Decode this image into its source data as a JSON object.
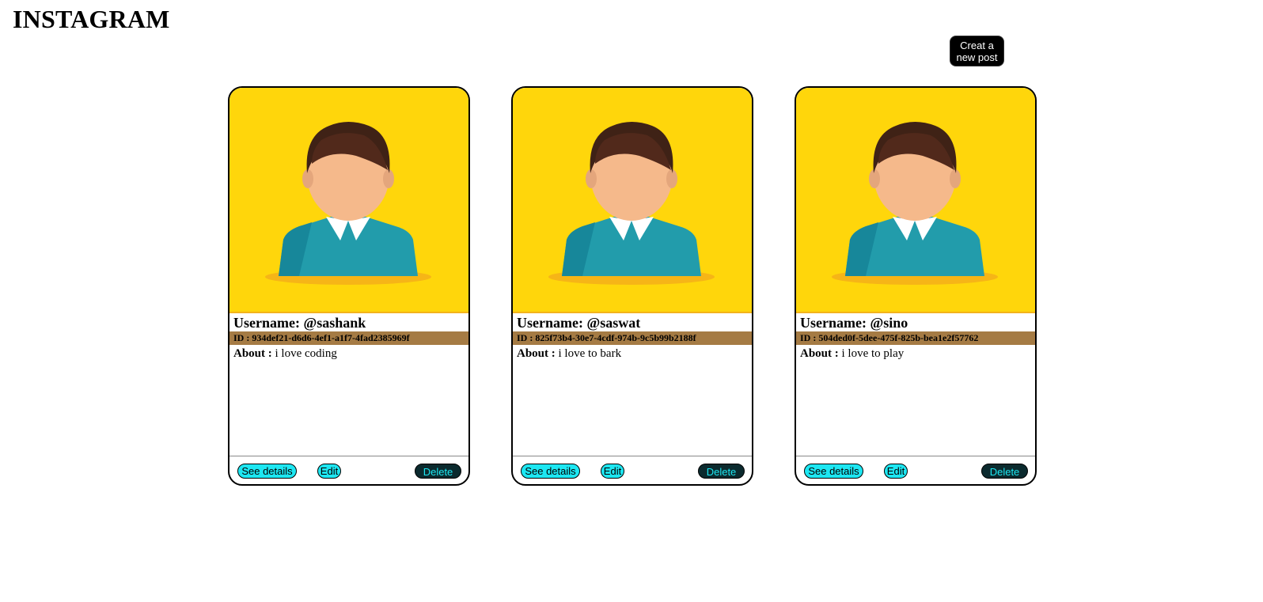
{
  "app": {
    "title": "INSTAGRAM"
  },
  "toolbar": {
    "create_label": "Creat a\nnew post"
  },
  "colors": {
    "avatar_bg": "#ffd60b",
    "id_bar": "#a57b44",
    "button_cyan": "#1de7f2",
    "delete_bg": "#0b2a2e"
  },
  "cards": [
    {
      "avatar_icon": "person-avatar-icon",
      "username_label": "Username:",
      "username": "@sashank",
      "id_label": "ID :",
      "id": "934def21-d6d6-4ef1-a1f7-4fad2385969f",
      "about_label": "About :",
      "about": "i love coding",
      "details_label": "See details",
      "edit_label": "Edit",
      "delete_label": "Delete"
    },
    {
      "avatar_icon": "person-avatar-icon",
      "username_label": "Username:",
      "username": "@saswat",
      "id_label": "ID :",
      "id": "825f73b4-30e7-4cdf-974b-9c5b99b2188f",
      "about_label": "About :",
      "about": "i love to bark",
      "details_label": "See details",
      "edit_label": "Edit",
      "delete_label": "Delete"
    },
    {
      "avatar_icon": "person-avatar-icon",
      "username_label": "Username:",
      "username": "@sino",
      "id_label": "ID :",
      "id": "504ded0f-5dee-475f-825b-bea1e2f57762",
      "about_label": "About :",
      "about": "i love to play",
      "details_label": "See details",
      "edit_label": "Edit",
      "delete_label": "Delete"
    }
  ]
}
